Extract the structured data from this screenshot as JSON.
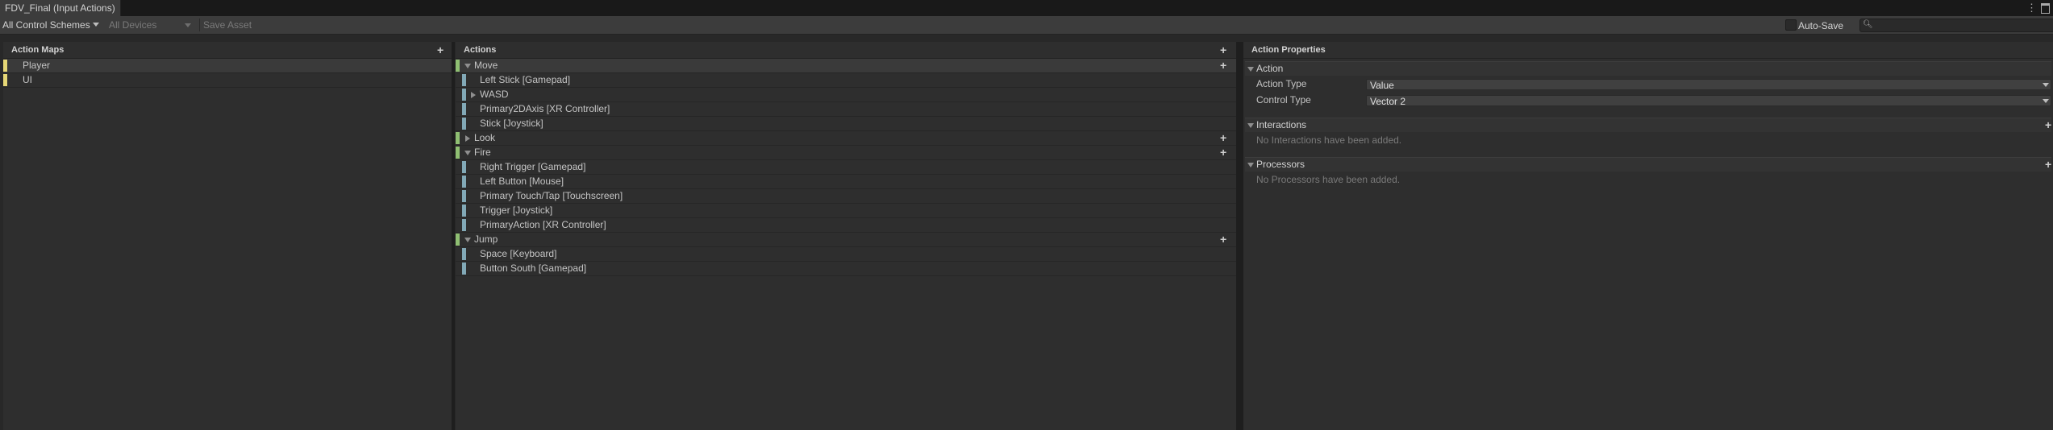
{
  "window": {
    "tab_title": "FDV_Final (Input Actions)"
  },
  "toolbar": {
    "control_schemes": "All Control Schemes",
    "devices": "All Devices",
    "save_asset": "Save Asset",
    "auto_save": "Auto-Save",
    "auto_save_checked": false,
    "search_value": ""
  },
  "action_maps": {
    "header": "Action Maps",
    "items": [
      {
        "label": "Player",
        "selected": true
      },
      {
        "label": "UI",
        "selected": false
      }
    ]
  },
  "actions": {
    "header": "Actions",
    "rows": [
      {
        "label": "Move",
        "kind": "action",
        "expanded": true,
        "selected": true
      },
      {
        "label": "Left Stick [Gamepad]",
        "kind": "binding"
      },
      {
        "label": "WASD",
        "kind": "composite",
        "expanded": false
      },
      {
        "label": "Primary2DAxis [XR Controller]",
        "kind": "binding"
      },
      {
        "label": "Stick [Joystick]",
        "kind": "binding"
      },
      {
        "label": "Look",
        "kind": "action",
        "expanded": false
      },
      {
        "label": "Fire",
        "kind": "action",
        "expanded": true
      },
      {
        "label": "Right Trigger [Gamepad]",
        "kind": "binding"
      },
      {
        "label": "Left Button [Mouse]",
        "kind": "binding"
      },
      {
        "label": "Primary Touch/Tap [Touchscreen]",
        "kind": "binding"
      },
      {
        "label": "Trigger [Joystick]",
        "kind": "binding"
      },
      {
        "label": "PrimaryAction [XR Controller]",
        "kind": "binding"
      },
      {
        "label": "Jump",
        "kind": "action",
        "expanded": true
      },
      {
        "label": "Space [Keyboard]",
        "kind": "binding"
      },
      {
        "label": "Button South [Gamepad]",
        "kind": "binding"
      }
    ]
  },
  "properties": {
    "header": "Action Properties",
    "action_section": "Action",
    "action_type_label": "Action Type",
    "action_type_value": "Value",
    "control_type_label": "Control Type",
    "control_type_value": "Vector 2",
    "interactions_section": "Interactions",
    "interactions_empty": "No Interactions have been added.",
    "processors_section": "Processors",
    "processors_empty": "No Processors have been added."
  },
  "colors": {
    "map_marker": "#e6d776",
    "action_marker": "#8fbf72",
    "binding_marker": "#82a9b7"
  }
}
